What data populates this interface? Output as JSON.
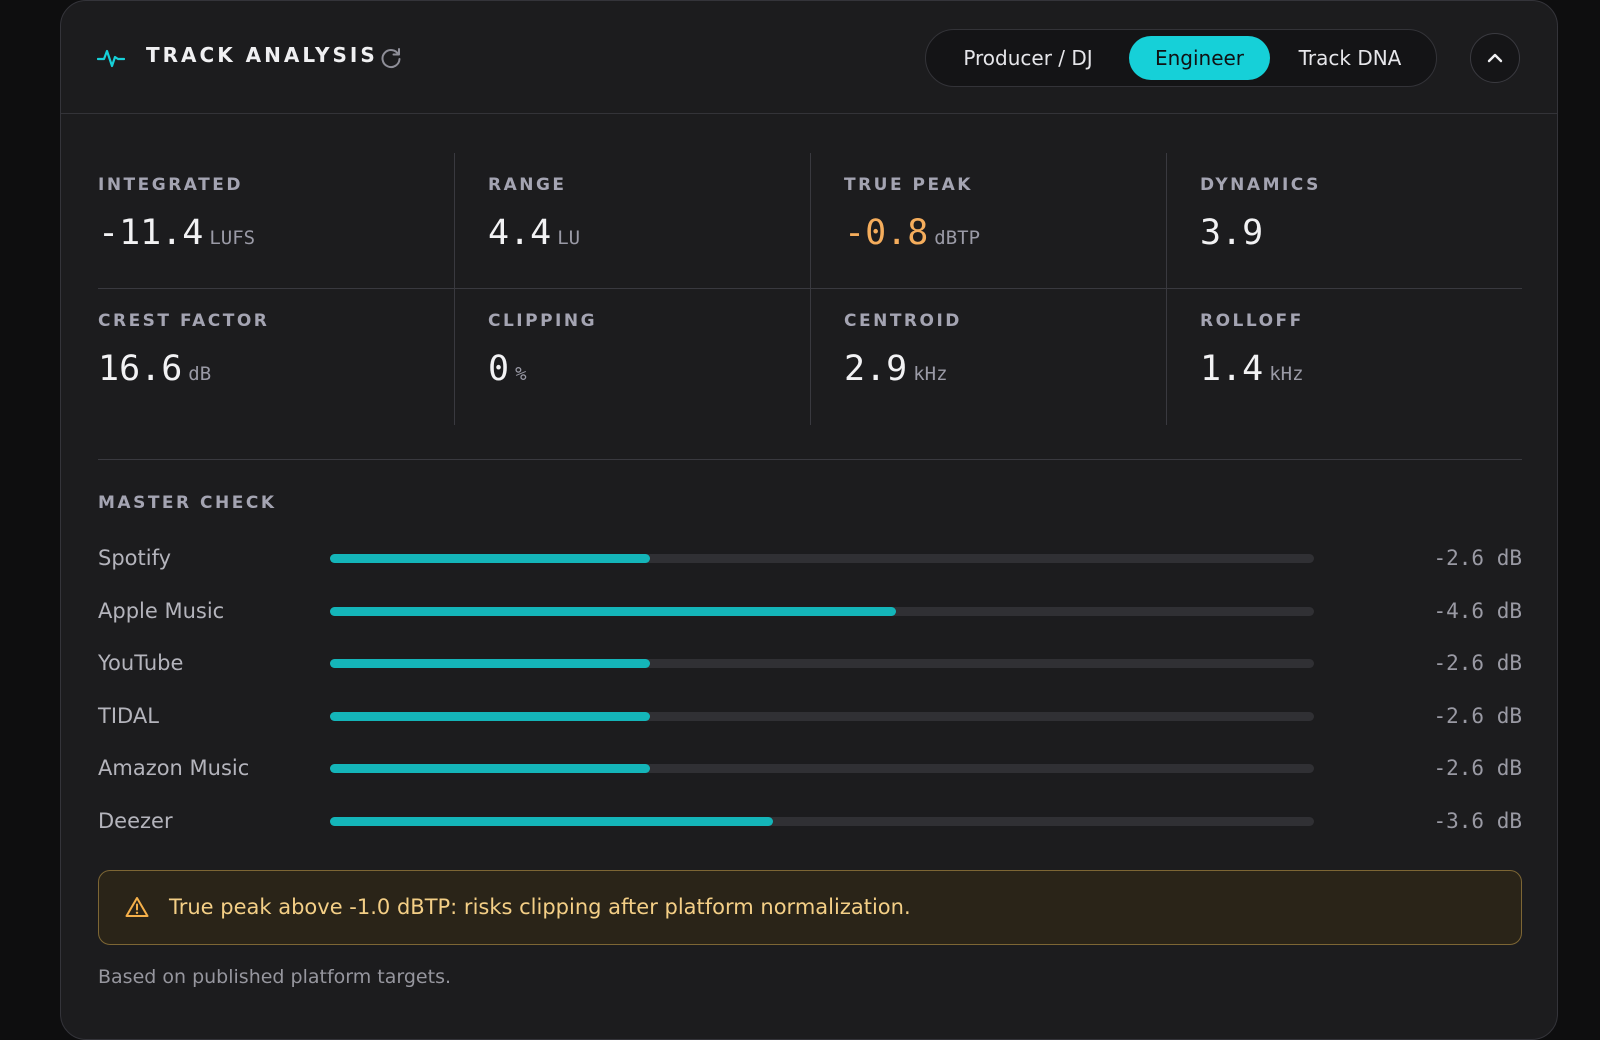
{
  "header": {
    "title": "TRACK ANALYSIS",
    "tabs": [
      {
        "label": "Producer / DJ",
        "active": false
      },
      {
        "label": "Engineer",
        "active": true
      },
      {
        "label": "Track DNA",
        "active": false
      }
    ],
    "icons": {
      "title": "pulse-icon",
      "refresh": "refresh-icon",
      "collapse": "chevron-up-icon"
    }
  },
  "metrics": [
    {
      "label": "INTEGRATED",
      "value": "-11.4",
      "unit": "LUFS"
    },
    {
      "label": "RANGE",
      "value": "4.4",
      "unit": "LU"
    },
    {
      "label": "TRUE PEAK",
      "value": "-0.8",
      "unit": "dBTP",
      "status": "warning"
    },
    {
      "label": "DYNAMICS",
      "value": "3.9",
      "unit": ""
    },
    {
      "label": "CREST FACTOR",
      "value": "16.6",
      "unit": "dB"
    },
    {
      "label": "CLIPPING",
      "value": "0",
      "unit": "%"
    },
    {
      "label": "CENTROID",
      "value": "2.9",
      "unit": "kHz"
    },
    {
      "label": "ROLLOFF",
      "value": "1.4",
      "unit": "kHz"
    }
  ],
  "master_check": {
    "label": "MASTER CHECK",
    "platforms": [
      {
        "name": "Spotify",
        "value": "-2.6 dB",
        "fill": 0.325
      },
      {
        "name": "Apple Music",
        "value": "-4.6 dB",
        "fill": 0.575
      },
      {
        "name": "YouTube",
        "value": "-2.6 dB",
        "fill": 0.325
      },
      {
        "name": "TIDAL",
        "value": "-2.6 dB",
        "fill": 0.325
      },
      {
        "name": "Amazon Music",
        "value": "-2.6 dB",
        "fill": 0.325
      },
      {
        "name": "Deezer",
        "value": "-3.6 dB",
        "fill": 0.45
      }
    ]
  },
  "warning": {
    "icon": "warning-triangle-icon",
    "text": "True peak above -1.0 dBTP: risks clipping after platform normalization."
  },
  "footnote": "Based on published platform targets.",
  "colors": {
    "accent": "#16d0d8",
    "bar_fill": "#14b5b9",
    "warning_value": "#f5ad5c",
    "warning_text": "#f4cf86",
    "panel_bg": "#1c1c1e"
  }
}
